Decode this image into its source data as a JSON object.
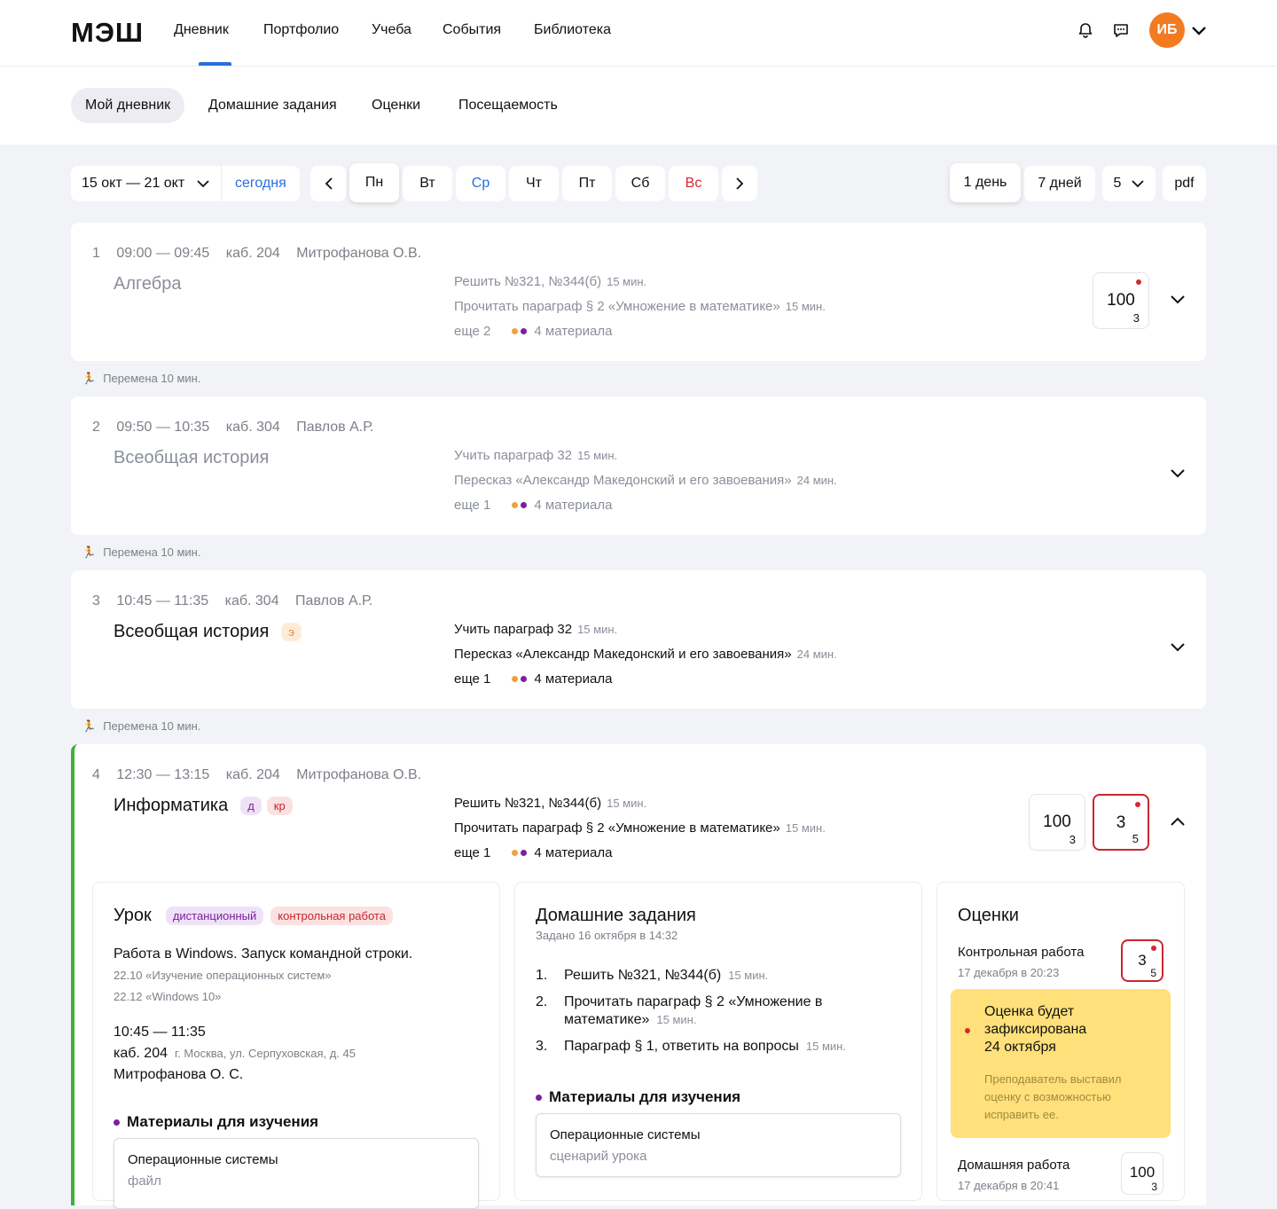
{
  "header": {
    "logo": "МЭШ",
    "nav": [
      "Дневник",
      "Портфолио",
      "Учеба",
      "События",
      "Библиотека"
    ],
    "avatar": "ИБ"
  },
  "subnav": [
    "Мой дневник",
    "Домашние задания",
    "Оценки",
    "Посещаемость"
  ],
  "toolbar": {
    "range": "15 окт — 21 окт",
    "today": "сегодня",
    "days": [
      "Пн",
      "Вт",
      "Ср",
      "Чт",
      "Пт",
      "Сб",
      "Вс"
    ],
    "view": [
      "1 день",
      "7 дней"
    ],
    "count": "5",
    "pdf": "pdf"
  },
  "break_label": "Перемена 10 мин.",
  "lessons": [
    {
      "num": "1",
      "time": "09:00 — 09:45",
      "room": "каб. 204",
      "teacher": "Митрофанова О.В.",
      "subject": "Алгебра",
      "hw1": "Решить №321, №344(б)",
      "hw1_min": "15 мин.",
      "hw2": "Прочитать параграф § 2 «Умножение в математике»",
      "hw2_min": "15 мин.",
      "more": "еще 2",
      "materials": "4 материала",
      "grade": "100",
      "grade_w": "3"
    },
    {
      "num": "2",
      "time": "09:50 — 10:35",
      "room": "каб. 304",
      "teacher": "Павлов А.Р.",
      "subject": "Всеобщая история",
      "hw1": "Учить параграф 32",
      "hw1_min": "15 мин.",
      "hw2": "Пересказ «Александр Македонский и его завоевания»",
      "hw2_min": "24 мин.",
      "more": "еще 1",
      "materials": "4 материала"
    },
    {
      "num": "3",
      "time": "10:45 — 11:35",
      "room": "каб. 304",
      "teacher": "Павлов А.Р.",
      "subject": "Всеобщая история",
      "tag": "э",
      "hw1": "Учить параграф 32",
      "hw1_min": "15 мин.",
      "hw2": "Пересказ «Александр Македонский и его завоевания»",
      "hw2_min": "24 мин.",
      "more": "еще 1",
      "materials": "4 материала"
    },
    {
      "num": "4",
      "time": "12:30 — 13:15",
      "room": "каб. 204",
      "teacher": "Митрофанова О.В.",
      "subject": "Информатика",
      "tag1": "д",
      "tag2": "кр",
      "hw1": "Решить №321, №344(б)",
      "hw1_min": "15 мин.",
      "hw2": "Прочитать параграф § 2 «Умножение в математике»",
      "hw2_min": "15 мин.",
      "more": "еще 1",
      "materials": "4 материала",
      "grade1": "100",
      "grade1_w": "3",
      "grade2": "3",
      "grade2_w": "5"
    }
  ],
  "lesson_panel": {
    "title": "Урок",
    "tag1": "дистанционный",
    "tag2": "контрольная работа",
    "topic": "Работа в Windows. Запуск командной строки.",
    "sub1": "22.10 «Изучение операционных систем»",
    "sub2": "22.12 «Windows 10»",
    "time": "10:45 — 11:35",
    "room": "каб. 204",
    "address": "г. Москва, ул. Серпуховская, д. 45",
    "teacher": "Митрофанова О. С.",
    "materials_title": "Материалы для изучения",
    "mat_name": "Операционные системы",
    "mat_type": "файл"
  },
  "hw_panel": {
    "title": "Домашние задания",
    "assigned": "Задано 16 октября в 14:32",
    "items": [
      {
        "n": "1.",
        "text": "Решить №321, №344(б)",
        "min": "15 мин."
      },
      {
        "n": "2.",
        "text": "Прочитать параграф § 2 «Умножение в",
        "text2": "математике»",
        "min": "15 мин."
      },
      {
        "n": "3.",
        "text": "Параграф § 1, ответить на вопросы",
        "min": "15 мин."
      }
    ],
    "materials_title": "Материалы для изучения",
    "mat_name": "Операционные системы",
    "mat_type": "сценарий урока"
  },
  "grades_panel": {
    "title": "Оценки",
    "g1_label": "Контрольная работа",
    "g1_date": "17 декабря в 20:23",
    "g1_value": "3",
    "g1_w": "5",
    "notice1": "Оценка будет",
    "notice2": "зафиксирована",
    "notice3": "24 октября",
    "notice_sub1": "Преподаватель выставил",
    "notice_sub2": "оценку с возможностью",
    "notice_sub3": "исправить ее.",
    "g2_label": "Домашняя работа",
    "g2_date": "17 декабря в 20:41",
    "g2_value": "100",
    "g2_w": "3"
  },
  "colors": {
    "accent": "#2a6ee0",
    "current_lesson": "#3cb13c",
    "orange_dot": "#f0a040",
    "purple_dot": "#7b1fa2",
    "red": "#d6282d",
    "notice_bg": "#ffe07a"
  }
}
